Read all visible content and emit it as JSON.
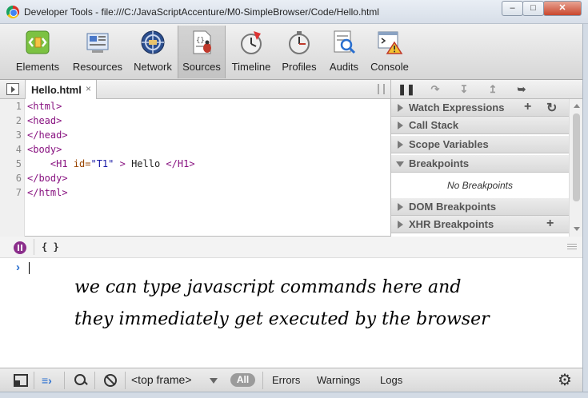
{
  "window": {
    "title": "Developer Tools - file:///C:/JavaScriptAccenture/M0-SimpleBrowser/Code/Hello.html"
  },
  "toolbar": {
    "tabs": [
      {
        "label": "Elements",
        "icon": "elements-icon"
      },
      {
        "label": "Resources",
        "icon": "resources-icon"
      },
      {
        "label": "Network",
        "icon": "network-icon"
      },
      {
        "label": "Sources",
        "icon": "sources-icon",
        "selected": true
      },
      {
        "label": "Timeline",
        "icon": "timeline-icon"
      },
      {
        "label": "Profiles",
        "icon": "profiles-icon"
      },
      {
        "label": "Audits",
        "icon": "audits-icon"
      },
      {
        "label": "Console",
        "icon": "console-icon"
      }
    ]
  },
  "sources": {
    "file_tab": "Hello.html",
    "close_glyph": "×",
    "lines": [
      {
        "n": "1",
        "text": "<html>"
      },
      {
        "n": "2",
        "text": "<head>"
      },
      {
        "n": "3",
        "text": "</head>"
      },
      {
        "n": "4",
        "text": "<body>"
      },
      {
        "n": "5",
        "text": "    <H1 id=\"T1\" > Hello </H1>"
      },
      {
        "n": "6",
        "text": "</body>"
      },
      {
        "n": "7",
        "text": "</html>"
      }
    ],
    "line5": {
      "open": "    <H1 ",
      "attr": "id=",
      "val": "\"T1\"",
      "close": " >",
      "text": " Hello ",
      "end": "</H1>"
    }
  },
  "debugger": {
    "panes": [
      {
        "label": "Watch Expressions",
        "expanded": false
      },
      {
        "label": "Call Stack",
        "expanded": false
      },
      {
        "label": "Scope Variables",
        "expanded": false
      },
      {
        "label": "Breakpoints",
        "expanded": true,
        "content": "No Breakpoints"
      },
      {
        "label": "DOM Breakpoints",
        "expanded": false
      },
      {
        "label": "XHR Breakpoints",
        "expanded": false
      }
    ],
    "add_glyph": "+",
    "refresh_glyph": "↻"
  },
  "console": {
    "pretty_print": "{ }",
    "prompt": "›",
    "note_lines": [
      "we can type javascript commands here and",
      "they immediately get executed by the browser"
    ]
  },
  "statusbar": {
    "frame": "<top frame>",
    "filters": [
      "All",
      "Errors",
      "Warnings",
      "Logs"
    ]
  },
  "colors": {
    "accent": "#2a6fcf",
    "pause": "#8b2e8b"
  }
}
